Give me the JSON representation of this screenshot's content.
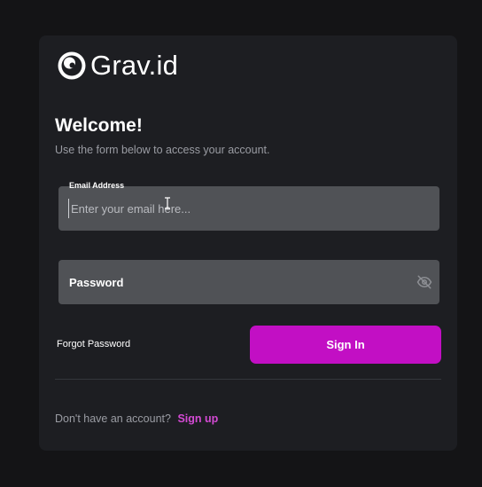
{
  "brand": {
    "name": "Grav.id",
    "logo_icon": "orbit-circle-icon"
  },
  "welcome": {
    "title": "Welcome!",
    "subtitle": "Use the form below to access your account."
  },
  "email_field": {
    "label": "Email Address",
    "placeholder": "Enter your email here...",
    "value": ""
  },
  "password_field": {
    "placeholder": "Password",
    "value": "",
    "toggle_icon": "eye-off-icon"
  },
  "actions": {
    "forgot_password": "Forgot Password",
    "sign_in": "Sign In"
  },
  "footer": {
    "prompt": "Don't have an account?",
    "sign_up": "Sign up"
  },
  "colors": {
    "background": "#141416",
    "card": "#1d1e22",
    "field": "#505256",
    "accent": "#c20fc4",
    "link": "#d44ad4"
  }
}
